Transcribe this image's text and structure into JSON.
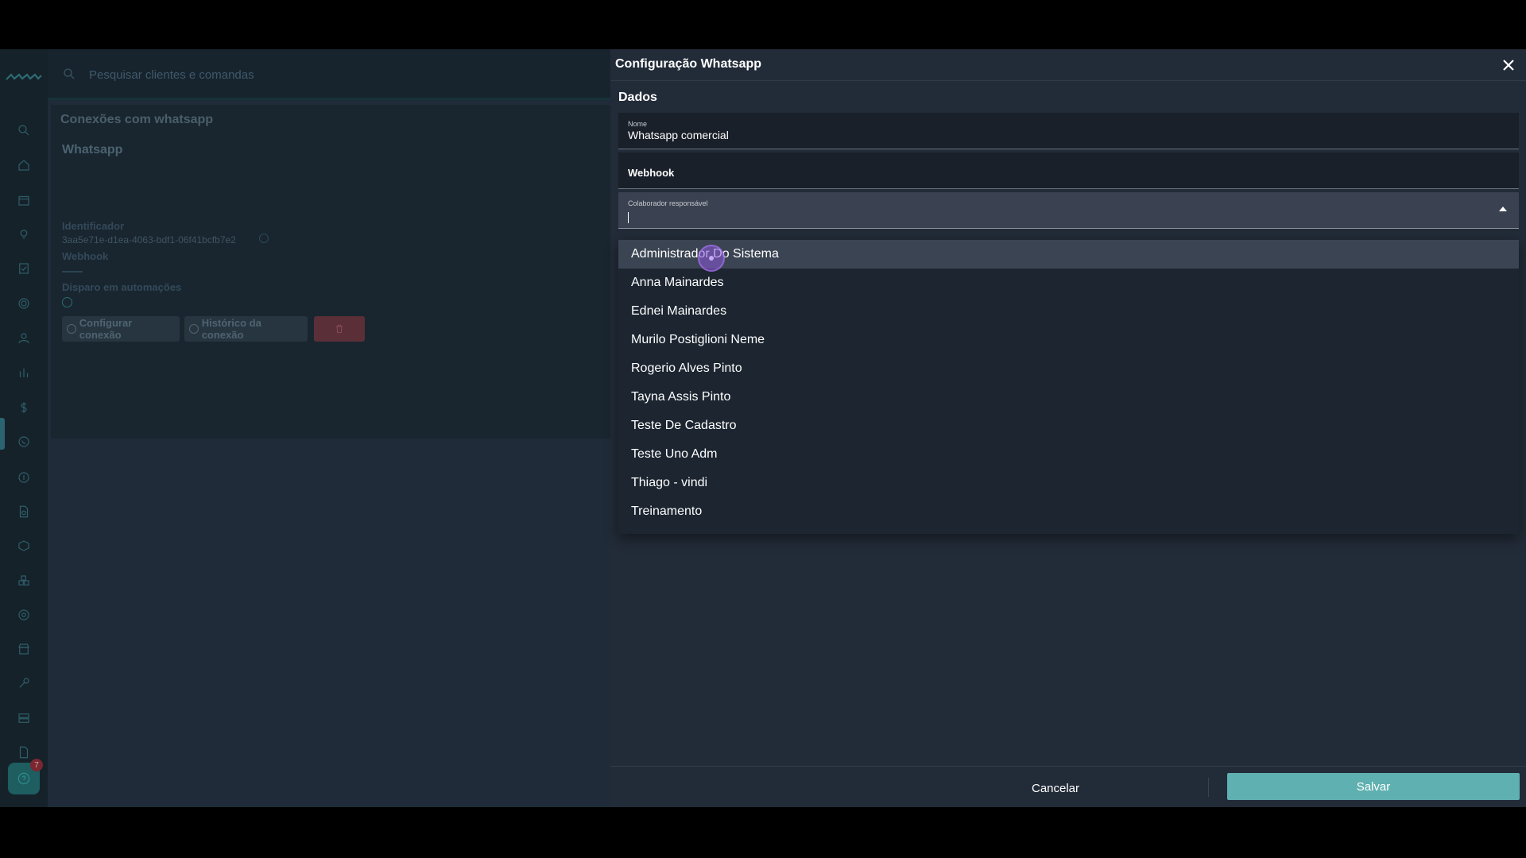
{
  "search": {
    "placeholder": "Pesquisar clientes e comandas"
  },
  "rail": {
    "icons": [
      "search-icon",
      "home-icon",
      "calendar-icon",
      "lightbulb-icon",
      "checklist-icon",
      "target-icon",
      "user-icon",
      "chart-icon",
      "dollar-icon",
      "whatsapp-icon",
      "coin-icon",
      "document-gear-icon",
      "box-icon",
      "cubes-icon",
      "settings-icon",
      "store-icon",
      "tool-icon",
      "server-icon",
      "file-icon"
    ],
    "chat_badge": "7"
  },
  "background": {
    "card_title": "Conexões com whatsapp",
    "connection_name": "Whatsapp",
    "identifier_label": "Identificador",
    "identifier_value": "3aa5e71e-d1ea-4063-bdf1-06f41bcfb7e2",
    "webhook_label": "Webhook",
    "automation_label": "Disparo em automações",
    "configure_button": "Configurar conexão",
    "history_button": "Histórico da conexão"
  },
  "drawer": {
    "title": "Configuração Whatsapp",
    "section": "Dados",
    "name_field": {
      "label": "Nome",
      "value": "Whatsapp comercial"
    },
    "webhook_field": {
      "placeholder": "Webhook"
    },
    "collaborator_field": {
      "label": "Colaborador responsável",
      "value": ""
    },
    "options": [
      "Administrador Do Sistema",
      "Anna Mainardes",
      "Ednei Mainardes",
      "Murilo Postiglioni Neme",
      "Rogerio Alves Pinto",
      "Tayna Assis Pinto",
      "Teste De Cadastro",
      "Teste Uno Adm",
      "Thiago - vindi",
      "Treinamento"
    ],
    "hovered_option_index": 0,
    "cancel_label": "Cancelar",
    "save_label": "Salvar"
  },
  "colors": {
    "accent": "#5fb0b0",
    "drawer_bg": "#222b38",
    "dropdown_hover": "#3b4452"
  }
}
